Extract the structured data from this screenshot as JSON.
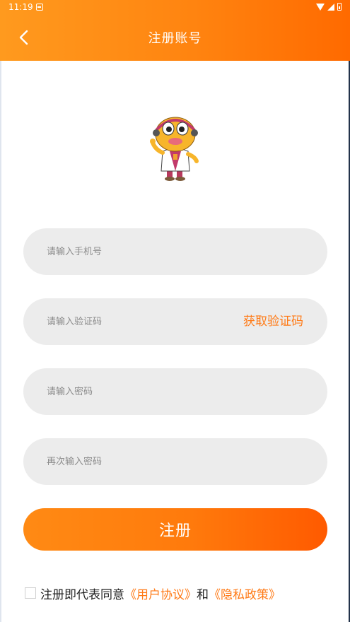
{
  "status_bar": {
    "time": "11:19"
  },
  "header": {
    "title": "注册账号",
    "back_icon": "chevron-left-icon"
  },
  "form": {
    "phone_placeholder": "请输入手机号",
    "code_placeholder": "请输入验证码",
    "get_code_label": "获取验证码",
    "password_placeholder": "请输入密码",
    "confirm_password_placeholder": "再次输入密码",
    "phone_value": "",
    "code_value": "",
    "password_value": "",
    "confirm_password_value": ""
  },
  "register_label": "注册",
  "agreement": {
    "prefix": "注册即代表同意",
    "user_agreement": "《用户协议》",
    "conjunction": "和",
    "privacy_policy": "《隐私政策》",
    "checked": false
  },
  "colors": {
    "accent": "#ff7a16",
    "header_gradient_start": "#ff9a1e",
    "header_gradient_end": "#ff6a00",
    "field_bg": "#ececec"
  }
}
